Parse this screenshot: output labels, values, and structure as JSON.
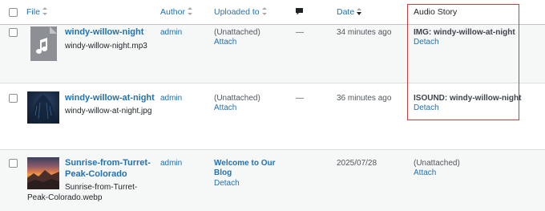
{
  "columns": {
    "file": "File",
    "author": "Author",
    "uploaded_to": "Uploaded to",
    "comments_icon": "comment-bubble-icon",
    "date": "Date",
    "audio_story": "Audio Story"
  },
  "rows": [
    {
      "thumb_icon": "music-note-file-icon",
      "title": "windy-willow-night",
      "filename": "windy-willow-night.mp3",
      "author": "admin",
      "uploaded_to": "(Unattached)",
      "uploaded_action": "Attach",
      "comments": "—",
      "date": "34 minutes ago",
      "story_text": "IMG: windy-willow-at-night",
      "story_action": "Detach"
    },
    {
      "thumb_icon": "night-tree-image",
      "title": "windy-willow-at-night",
      "filename": "windy-willow-at-night.jpg",
      "author": "admin",
      "uploaded_to": "(Unattached)",
      "uploaded_action": "Attach",
      "comments": "—",
      "date": "36 minutes ago",
      "story_text": "ISOUND: windy-willow-night",
      "story_action": "Detach"
    },
    {
      "thumb_icon": "sunrise-landscape-image",
      "title_line1": "Sunrise-from-Turret-",
      "title_line2": "Peak-Colorado",
      "filename_line1": "Sunrise-from-Turret-",
      "filename_line2": "Peak-Colorado.webp",
      "author": "admin",
      "uploaded_to_line1": "Welcome to Our",
      "uploaded_to_line2": "Blog",
      "uploaded_action": "Detach",
      "comments": "",
      "date": "2025/07/28",
      "story_text": "(Unattached)",
      "story_action": "Attach"
    }
  ],
  "colors": {
    "link": "#2271b1",
    "highlight_border": "#d63638",
    "row_alt": "#f6f7f7"
  }
}
